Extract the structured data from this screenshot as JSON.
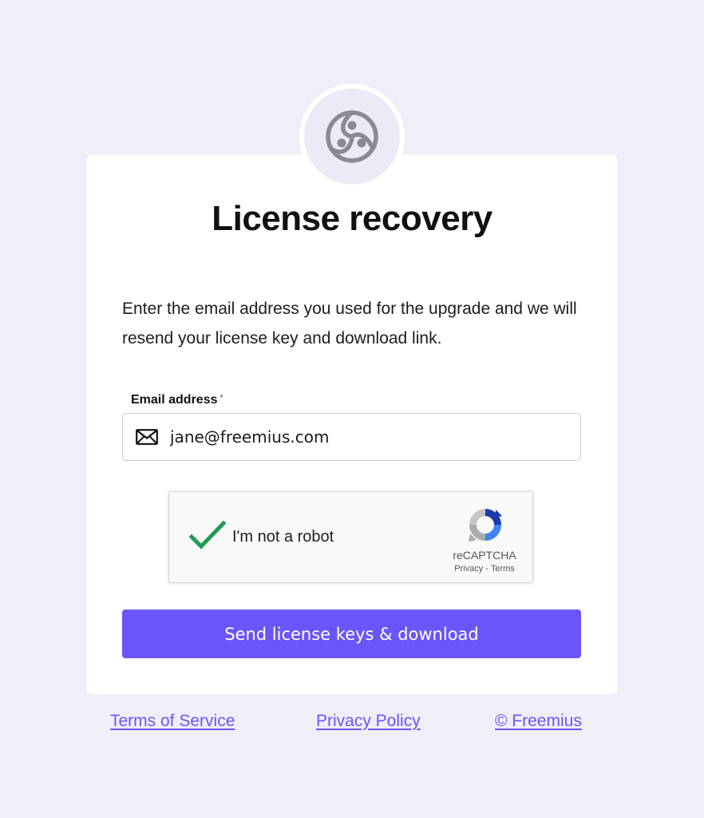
{
  "page": {
    "title": "License recovery",
    "description": "Enter the email address you used for the upgrade and we will resend your license key and download link."
  },
  "form": {
    "email_label": "Email address",
    "required_mark": "*",
    "email_value": "jane@freemius.com",
    "email_icon": "envelope-icon",
    "submit_label": "Send license keys & download"
  },
  "captcha": {
    "label": "I'm not a robot",
    "brand": "reCAPTCHA",
    "privacy": "Privacy",
    "separator": "-",
    "terms": "Terms",
    "checked": true
  },
  "footer": {
    "links": [
      {
        "label": "Terms of Service"
      },
      {
        "label": "Privacy Policy"
      },
      {
        "label": "© Freemius"
      }
    ]
  },
  "colors": {
    "background": "#efeff9",
    "accent": "#6a55fb",
    "logo_gray": "#8a8a94",
    "check_green": "#1f9d55"
  }
}
